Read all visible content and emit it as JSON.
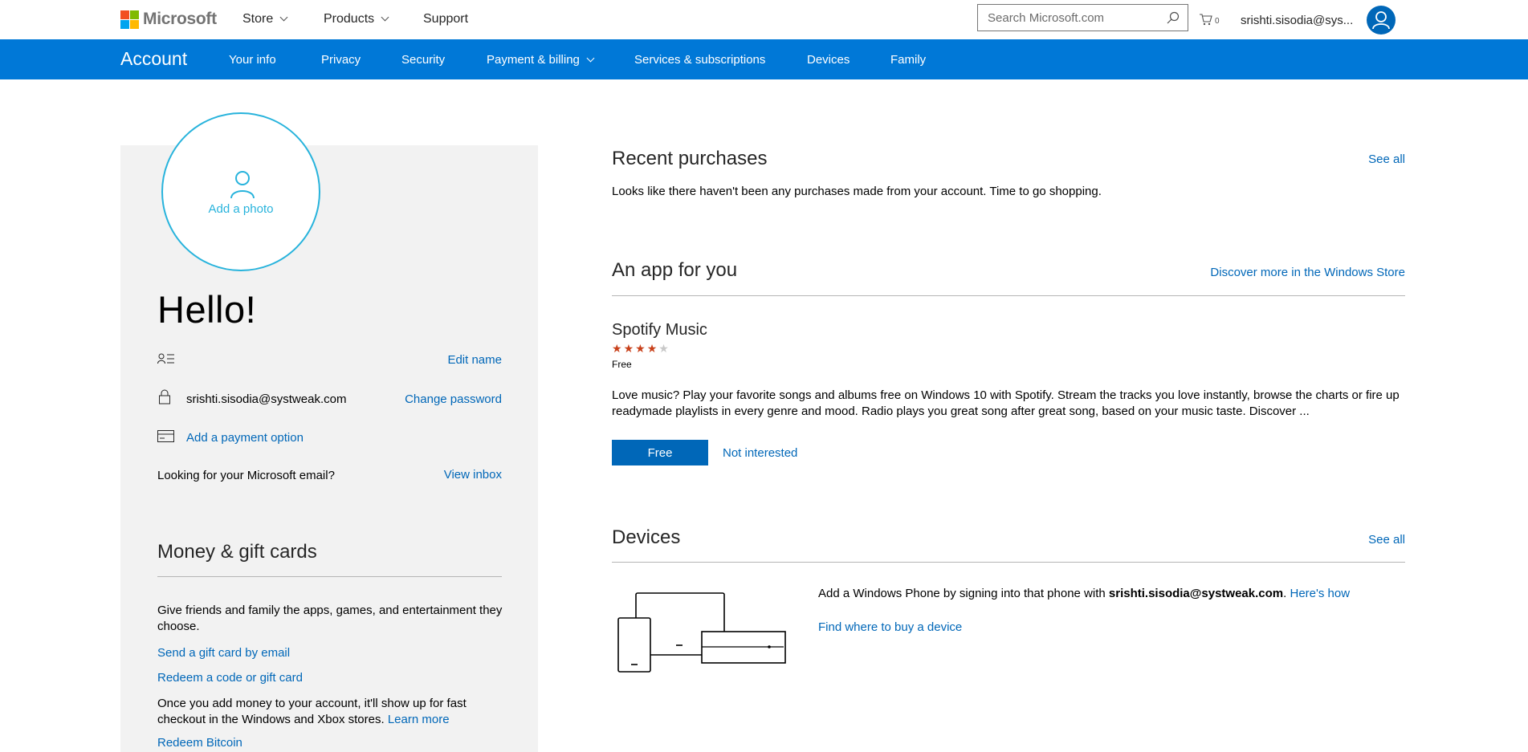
{
  "header": {
    "brand": "Microsoft",
    "nav": [
      {
        "label": "Store",
        "has_dropdown": true
      },
      {
        "label": "Products",
        "has_dropdown": true
      },
      {
        "label": "Support",
        "has_dropdown": false
      }
    ],
    "search": {
      "placeholder": "Search Microsoft.com",
      "value": ""
    },
    "cart_count": "0",
    "user_email": "srishti.sisodia@sys..."
  },
  "account_nav": {
    "brand": "Account",
    "tabs": [
      {
        "label": "Your info"
      },
      {
        "label": "Privacy"
      },
      {
        "label": "Security"
      },
      {
        "label": "Payment & billing",
        "has_dropdown": true
      },
      {
        "label": "Services & subscriptions"
      },
      {
        "label": "Devices"
      },
      {
        "label": "Family"
      }
    ]
  },
  "profile": {
    "add_photo": "Add a photo",
    "greeting": "Hello!",
    "edit_name": "Edit name",
    "email": "srishti.sisodia@systweak.com",
    "change_password": "Change password",
    "add_payment": "Add a payment option",
    "ms_email_prompt": "Looking for your Microsoft email?",
    "view_inbox": "View inbox"
  },
  "money": {
    "title": "Money & gift cards",
    "description": "Give friends and family the apps, games, and entertainment they choose.",
    "send_gift": "Send a gift card by email",
    "redeem_code": "Redeem a code or gift card",
    "add_money_text": "Once you add money to your account, it'll show up for fast checkout in the Windows and Xbox stores.",
    "learn_more": "Learn more",
    "redeem_bitcoin": "Redeem Bitcoin"
  },
  "recent_purchases": {
    "title": "Recent purchases",
    "see_all": "See all",
    "empty_text": "Looks like there haven't been any purchases made from your account. Time to go shopping."
  },
  "app_for_you": {
    "title": "An app for you",
    "discover_link": "Discover more in the Windows Store",
    "app_name": "Spotify Music",
    "rating": 4,
    "rating_max": 5,
    "price": "Free",
    "description": "Love music? Play your favorite songs and albums free on Windows 10 with Spotify. Stream the tracks you love instantly, browse the charts or fire up readymade playlists in every genre and mood. Radio plays you great song after great song, based on your music taste. Discover ...",
    "cta_label": "Free",
    "not_interested": "Not interested"
  },
  "devices": {
    "title": "Devices",
    "see_all": "See all",
    "add_phone_prefix": "Add a Windows Phone by signing into that phone with ",
    "add_phone_email": "srishti.sisodia@systweak.com",
    "add_phone_suffix": ".",
    "heres_how": "Here's how",
    "find_device": "Find where to buy a device"
  },
  "colors": {
    "accent_blue": "#0078d7",
    "link_blue": "#0067b8",
    "photo_cyan": "#27b3dc",
    "star_filled": "#c8401a",
    "star_empty": "#c8c8c8",
    "panel_gray": "#f2f2f2"
  }
}
